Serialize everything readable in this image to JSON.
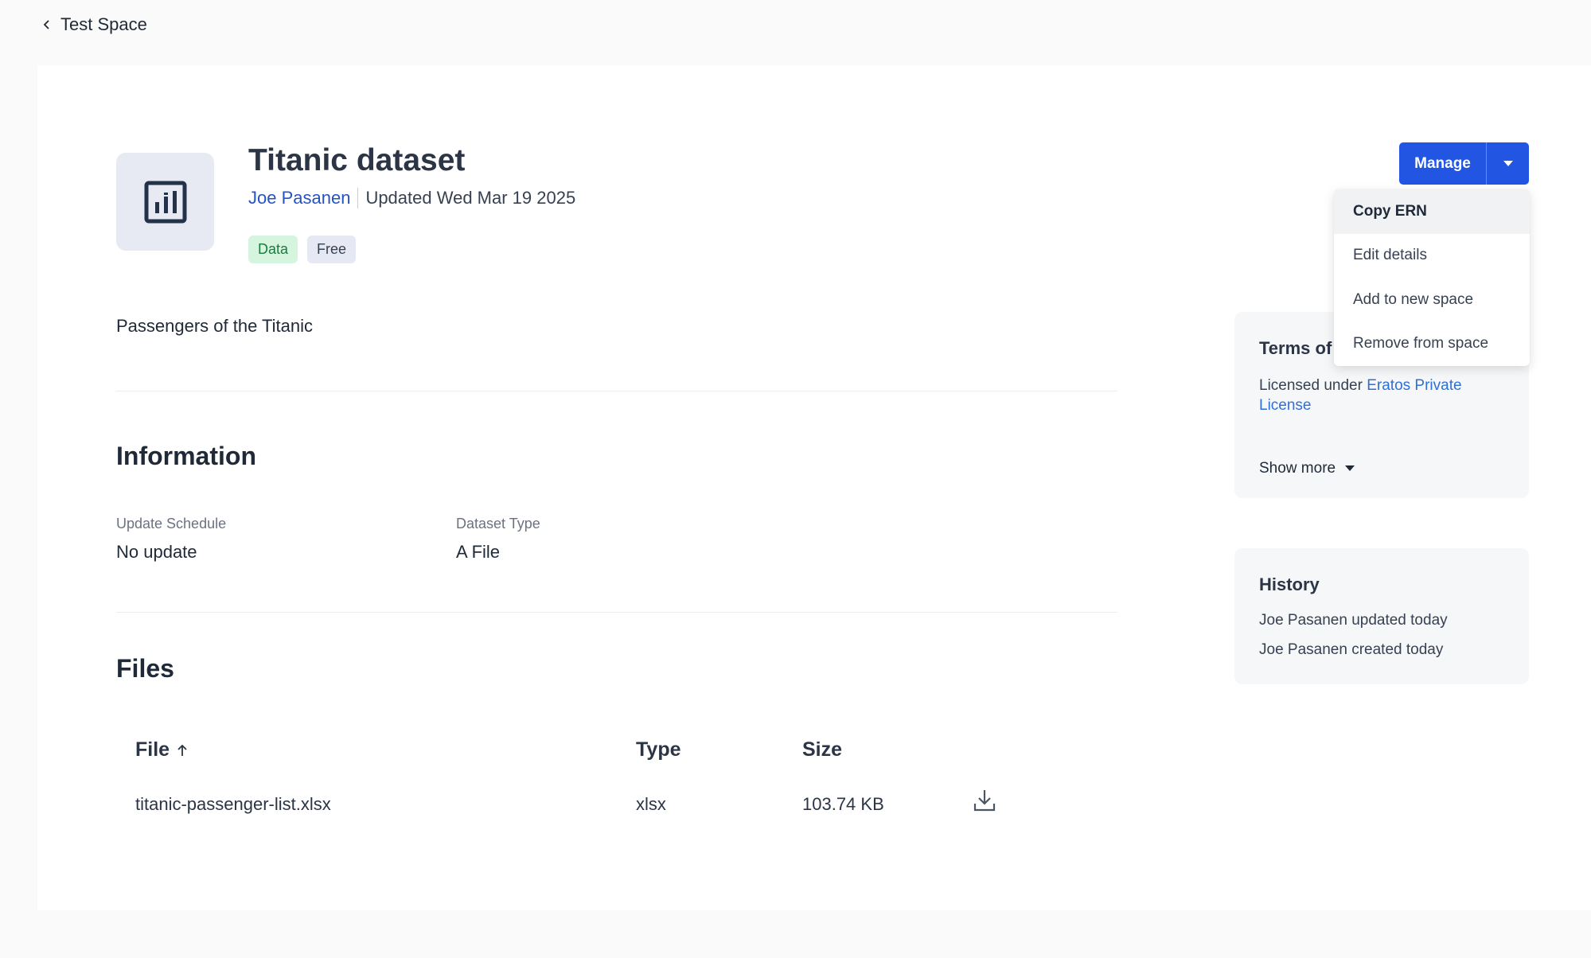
{
  "back": {
    "label": "Test Space"
  },
  "dataset": {
    "title": "Titanic dataset",
    "author": "Joe Pasanen",
    "updated": "Updated Wed Mar 19 2025",
    "tags": [
      "Data",
      "Free"
    ],
    "description": "Passengers of the Titanic"
  },
  "information": {
    "heading": "Information",
    "fields": [
      {
        "label": "Update Schedule",
        "value": "No update"
      },
      {
        "label": "Dataset Type",
        "value": "A File"
      }
    ]
  },
  "files": {
    "heading": "Files",
    "columns": [
      "File",
      "Type",
      "Size"
    ],
    "sort_indicator": "arrow-up-icon",
    "rows": [
      {
        "file": "titanic-passenger-list.xlsx",
        "type": "xlsx",
        "size": "103.74 KB"
      }
    ]
  },
  "manage": {
    "label": "Manage",
    "menu": [
      "Copy ERN",
      "Edit details",
      "Add to new space",
      "Remove from space"
    ],
    "active_item": "Copy ERN"
  },
  "terms": {
    "heading": "Terms of",
    "licensed_prefix": "Licensed under ",
    "license_link_line1": "Eratos Private",
    "license_link_line2": "License",
    "show_more": "Show more"
  },
  "history": {
    "heading": "History",
    "entries": [
      "Joe Pasanen updated today",
      "Joe Pasanen created today"
    ]
  },
  "colors": {
    "accent": "#2155e2",
    "link": "#2453c7",
    "tag_data_bg": "#d6f5df",
    "tag_free_bg": "#e6e8f3"
  }
}
